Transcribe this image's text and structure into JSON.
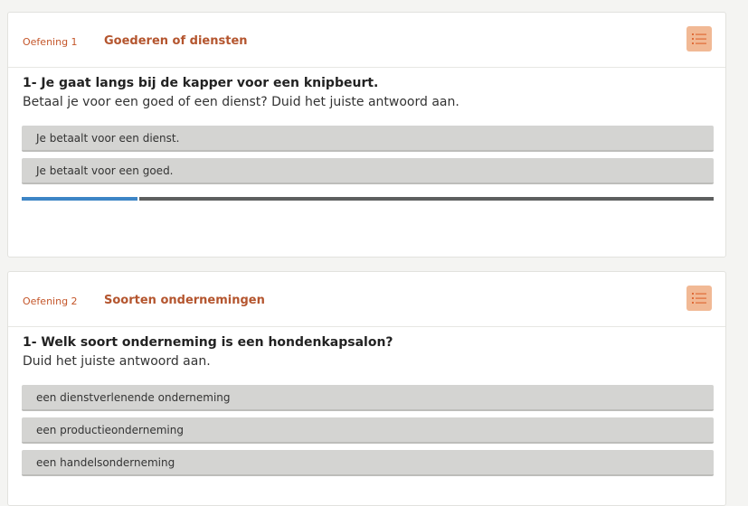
{
  "exercises": [
    {
      "number_label": "Oefening 1",
      "title": "Goederen of diensten",
      "question_title": "1- Je gaat langs bij de kapper voor een knipbeurt.",
      "question_sub": "Betaal je voor een goed of een dienst? Duid het juiste antwoord aan.",
      "options": [
        "Je betaalt voor een dienst.",
        "Je betaalt voor een goed."
      ],
      "progress_fraction": 0.167
    },
    {
      "number_label": "Oefening 2",
      "title": "Soorten ondernemingen",
      "question_title": "1- Welk soort onderneming is een hondenkapsalon?",
      "question_sub": "Duid het juiste antwoord aan.",
      "options": [
        "een dienstverlenende onderneming",
        "een productieonderneming",
        "een handelsonderneming"
      ]
    }
  ],
  "icons": {
    "exercise_list": "list-icon"
  },
  "colors": {
    "accent": "#b4552e",
    "icon_button": "#f1b995",
    "progress_fill": "#3d85c6",
    "progress_track": "#5d5f5f",
    "option_bg": "#d4d4d2"
  }
}
